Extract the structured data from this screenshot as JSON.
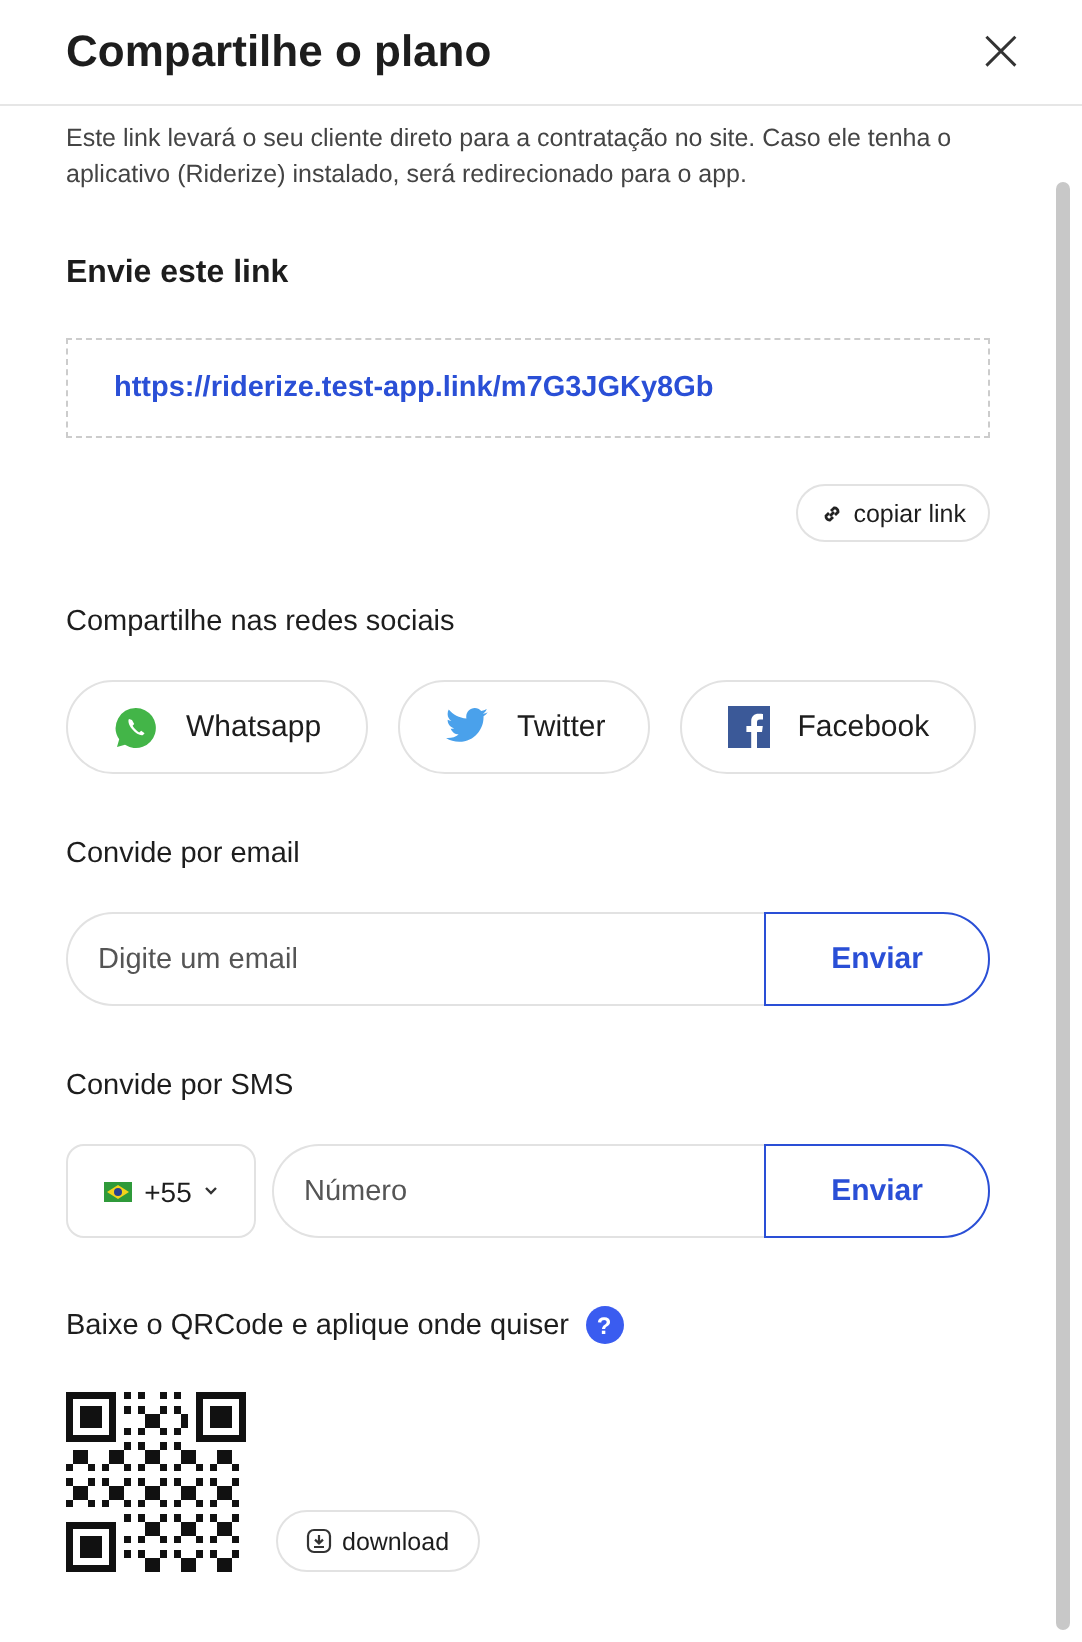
{
  "header": {
    "title": "Compartilhe o plano",
    "close": "×"
  },
  "description": "Este link levará o seu cliente direto para a contratação no site. Caso ele tenha o aplicativo (Riderize) instalado, será redirecionado para o app.",
  "link_section": {
    "heading": "Envie este link",
    "url": "https://riderize.test-app.link/m7G3JGKy8Gb",
    "copy_button": "copiar link"
  },
  "social_section": {
    "heading": "Compartilhe nas redes sociais",
    "buttons": [
      {
        "kind": "whatsapp",
        "label": "Whatsapp"
      },
      {
        "kind": "twitter",
        "label": "Twitter"
      },
      {
        "kind": "facebook",
        "label": "Facebook"
      }
    ]
  },
  "email_section": {
    "heading": "Convide por email",
    "placeholder": "Digite um email",
    "button": "Enviar"
  },
  "sms_section": {
    "heading": "Convide por SMS",
    "country_code": "+55",
    "placeholder": "Número",
    "button": "Enviar"
  },
  "qr_section": {
    "heading": "Baixe o QRCode e aplique onde quiser",
    "help": "?",
    "download_button": "download"
  }
}
